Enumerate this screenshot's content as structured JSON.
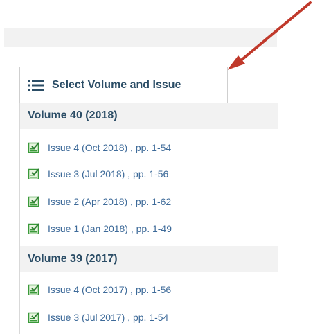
{
  "colors": {
    "heading": "#2b4d66",
    "link": "#3d6a99",
    "icon_green": "#3a9a3a",
    "arrow": "#c0392b",
    "band": "#f2f2f2"
  },
  "tab": {
    "icon": "list-icon",
    "label": "Select Volume and Issue"
  },
  "volumes": [
    {
      "title": "Volume 40 (2018)",
      "issues": [
        {
          "label": "Issue 4 (Oct 2018) , pp. 1-54",
          "icon": "document-check-icon"
        },
        {
          "label": "Issue 3 (Jul 2018) , pp. 1-56",
          "icon": "document-check-icon"
        },
        {
          "label": "Issue 2 (Apr 2018) , pp. 1-62",
          "icon": "document-check-icon"
        },
        {
          "label": "Issue 1 (Jan 2018) , pp. 1-49",
          "icon": "document-check-icon"
        }
      ]
    },
    {
      "title": "Volume 39 (2017)",
      "issues": [
        {
          "label": "Issue 4 (Oct 2017) , pp. 1-56",
          "icon": "document-check-icon"
        },
        {
          "label": "Issue 3 (Jul 2017) , pp. 1-54",
          "icon": "document-check-icon"
        }
      ]
    }
  ]
}
